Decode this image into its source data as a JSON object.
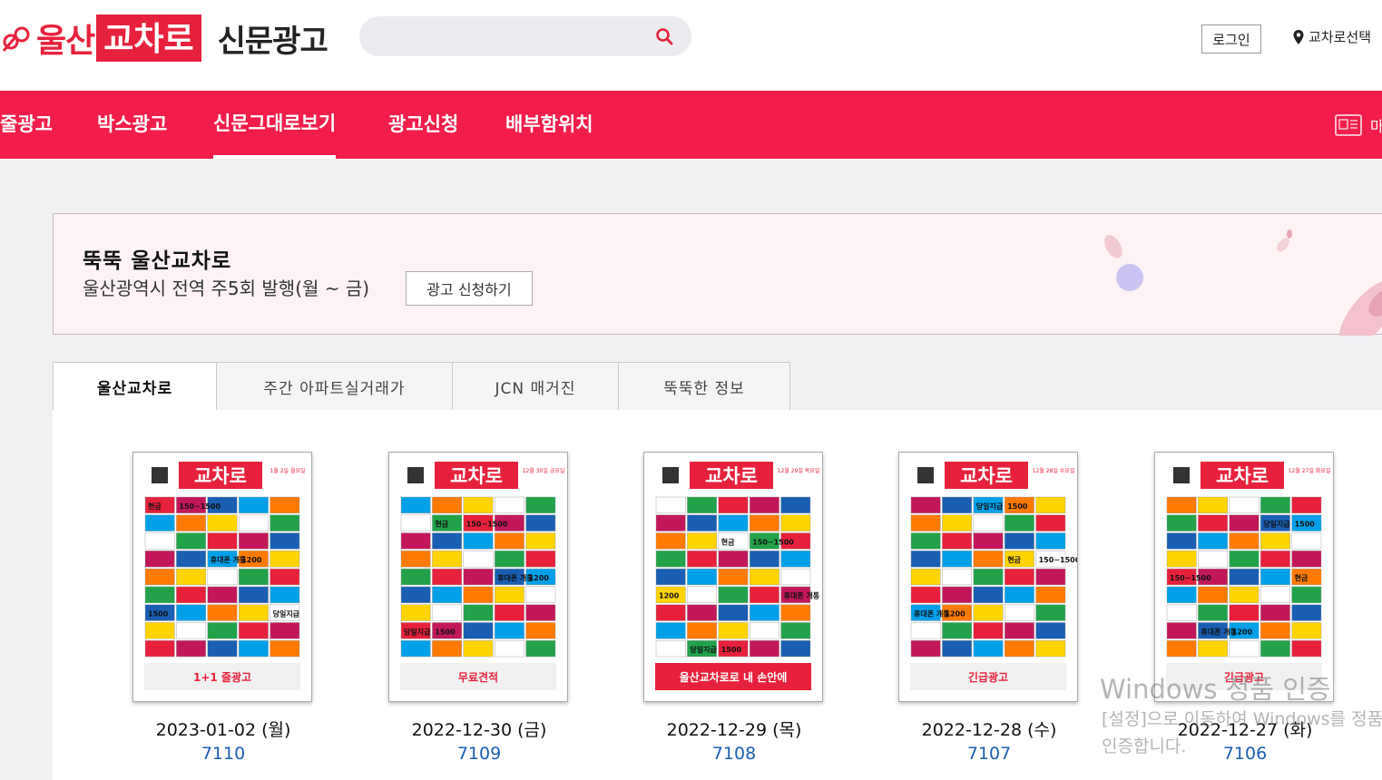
{
  "header": {
    "logo_main": "울산",
    "logo_box": "교차로",
    "logo_sub": "신문광고",
    "search_placeholder": "",
    "login_label": "로그인",
    "region_label": "교차로선택"
  },
  "nav": {
    "items": [
      {
        "label": "줄광고"
      },
      {
        "label": "박스광고"
      },
      {
        "label": "신문그대로보기"
      },
      {
        "label": "광고신청"
      },
      {
        "label": "배부함위치"
      }
    ],
    "active_index": 2,
    "right_text": "마"
  },
  "banner": {
    "title": "뚝뚝 울산교차로",
    "subtitle": "울산광역시 전역 주5회 발행(월 ~ 금)",
    "button_label": "광고 신청하기"
  },
  "tabs": [
    {
      "label": "울산교차로"
    },
    {
      "label": "주간 아파트실거래가"
    },
    {
      "label": "JCN 매거진"
    },
    {
      "label": "뚝뚝한 정보"
    }
  ],
  "issues": [
    {
      "date": "2023-01-02 (월)",
      "number": "7110",
      "masthead_date": "1월 2일 월요일",
      "footer": "1+1 줄광고"
    },
    {
      "date": "2022-12-30 (금)",
      "number": "7109",
      "masthead_date": "12월 30일 금요일",
      "footer": "무료견적"
    },
    {
      "date": "2022-12-29 (목)",
      "number": "7108",
      "masthead_date": "12월 29일 목요일",
      "footer": "울산교차로로 내 손안에"
    },
    {
      "date": "2022-12-28 (수)",
      "number": "7107",
      "masthead_date": "12월 28일 수요일",
      "footer": "긴급광고"
    },
    {
      "date": "2022-12-27 (화)",
      "number": "7106",
      "masthead_date": "12월 27일 화요일",
      "footer": "긴급광고"
    }
  ],
  "thumb_masthead": "교차로",
  "thumb_ad_texts": [
    "현금",
    "휴대폰 개통",
    "당일지급",
    "150~1500",
    "1200",
    "1500"
  ],
  "watermark": {
    "line1": "Windows 정품 인증",
    "line2": "[설정]으로 이동하여 Windows를 정품 인증합니다."
  },
  "colors": {
    "brand": "#e7213b",
    "nav_bg": "#f21d4b",
    "link": "#1a5fb4"
  }
}
